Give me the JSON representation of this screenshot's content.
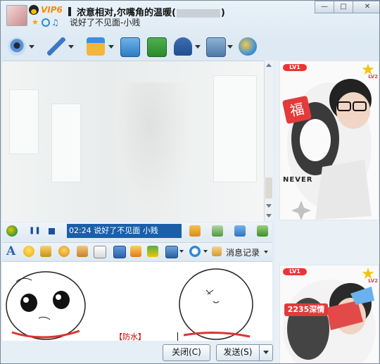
{
  "title": {
    "vip": "VIP6",
    "contact_name_prefix": "浓意相对,尔嘴角的温暖(",
    "contact_name_suffix": ")",
    "signature": "说好了不见面-小贱"
  },
  "window_buttons": {
    "minimize": "—",
    "maximize": "□",
    "close": "✕"
  },
  "main_toolbar": {
    "icons": [
      "video-chat-icon",
      "voice-chat-icon",
      "send-file-icon",
      "send-email-icon",
      "create-group-icon",
      "remote-assist-icon",
      "settings-icon",
      "app-icon"
    ]
  },
  "music_bar": {
    "now_playing": "02:24 说好了不见面  小贱"
  },
  "input_toolbar": {
    "message_record": "消息记录"
  },
  "input_area": {
    "tag": "【防水】"
  },
  "buttons": {
    "close": "关闭(C)",
    "send": "发送(S)"
  },
  "show_panel": {
    "top_level": "LV1",
    "top_star_level": "LV2",
    "top_caption": "NEVER",
    "top_badge": "福",
    "bottom_level": "LV1",
    "bottom_star_level": "LV2",
    "bottom_badge": "2235深情"
  }
}
